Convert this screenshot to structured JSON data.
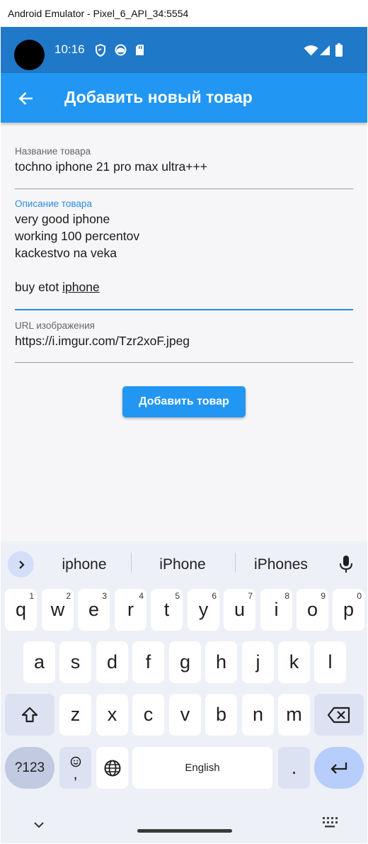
{
  "window": {
    "title": "Android Emulator - Pixel_6_API_34:5554"
  },
  "status_bar": {
    "time": "10:16"
  },
  "app_bar": {
    "title": "Добавить новый товар"
  },
  "form": {
    "name": {
      "label": "Название товара",
      "value": "tochno iphone 21 pro max ultra+++"
    },
    "description": {
      "label": "Описание товара",
      "lines": [
        "very good iphone",
        "working 100 percentov",
        "kackestvo na veka",
        "",
        "buy etot "
      ],
      "underlined_word": "iphone"
    },
    "image_url": {
      "label": "URL изображения",
      "value": "https://i.imgur.com/Tzr2xoF.jpeg"
    },
    "submit_label": "Добавить товар"
  },
  "colors": {
    "primary": "#2196f3",
    "status_bar": "#1f78c8",
    "focus": "#2a8be6"
  },
  "keyboard": {
    "suggestions": [
      "iphone",
      "iPhone",
      "iPhones"
    ],
    "row1": [
      [
        "q",
        "1"
      ],
      [
        "w",
        "2"
      ],
      [
        "e",
        "3"
      ],
      [
        "r",
        "4"
      ],
      [
        "t",
        "5"
      ],
      [
        "y",
        "6"
      ],
      [
        "u",
        "7"
      ],
      [
        "i",
        "8"
      ],
      [
        "o",
        "9"
      ],
      [
        "p",
        "0"
      ]
    ],
    "row2": [
      "a",
      "s",
      "d",
      "f",
      "g",
      "h",
      "j",
      "k",
      "l"
    ],
    "row3": [
      "z",
      "x",
      "c",
      "v",
      "b",
      "n",
      "m"
    ],
    "numbers_label": "?123",
    "comma_label": ",",
    "space_label": "English",
    "period_label": "."
  }
}
